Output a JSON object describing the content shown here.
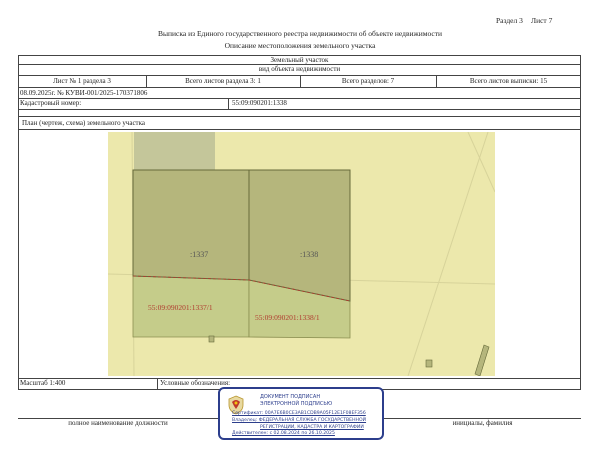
{
  "header": {
    "section_label": "Раздел 3",
    "sheet_label": "Лист 7",
    "title": "Выписка из Единого государственного реестра недвижимости об объекте недвижимости",
    "subtitle": "Описание местоположения земельного участка"
  },
  "object": {
    "type": "Земельный участок",
    "type_caption": "вид объекта недвижимости"
  },
  "sheet_info": {
    "sheet_of_section": "Лист № 1 раздела 3",
    "sheets_in_section": "Всего листов раздела 3: 1",
    "total_sections": "Всего разделов: 7",
    "total_sheets": "Всего листов выписки: 15"
  },
  "record": {
    "date_number": "08.09.2025г. № КУВИ-001/2025-170371806",
    "cadastral_label": "Кадастровый номер:",
    "cadastral_value": "55:09:090201:1338"
  },
  "plan": {
    "caption": "План (чертеж, схема) земельного участка",
    "parcel_a_label": ":1337",
    "parcel_b_label": ":1338",
    "parcel_a_full": "55:09:090201:1337/1",
    "parcel_b_full": "55:09:090201:1338/1"
  },
  "footer": {
    "scale": "Масштаб 1:400",
    "legend_label": "Условные обозначения:",
    "position_label": "полное наименование должности",
    "initials_label": "инициалы, фамилия"
  },
  "stamp": {
    "line1": "ДОКУМЕНТ ПОДПИСАН",
    "line2": "ЭЛЕКТРОННОЙ ПОДПИСЬЮ",
    "cert": "Сертификат: 00A7E6B0CE3AB1CDB9A05F12E1F08EF356",
    "owner": "Владелец: ФЕДЕРАЛЬНАЯ СЛУЖБА ГОСУДАРСТВЕННОЙ",
    "owner2": "РЕГИСТРАЦИИ, КАДАСТРА И КАРТОГРАФИИ",
    "valid": "Действителен: с 02.08.2024 по 26.10.2025"
  },
  "colors": {
    "map_bg": "#ece8ac",
    "parcel_dark": "#b5b67c",
    "parcel_light": "#c5cc8a",
    "strip": "#c4c69a",
    "label_red": "#b03a2e",
    "stamp_blue": "#2c3e8c"
  }
}
